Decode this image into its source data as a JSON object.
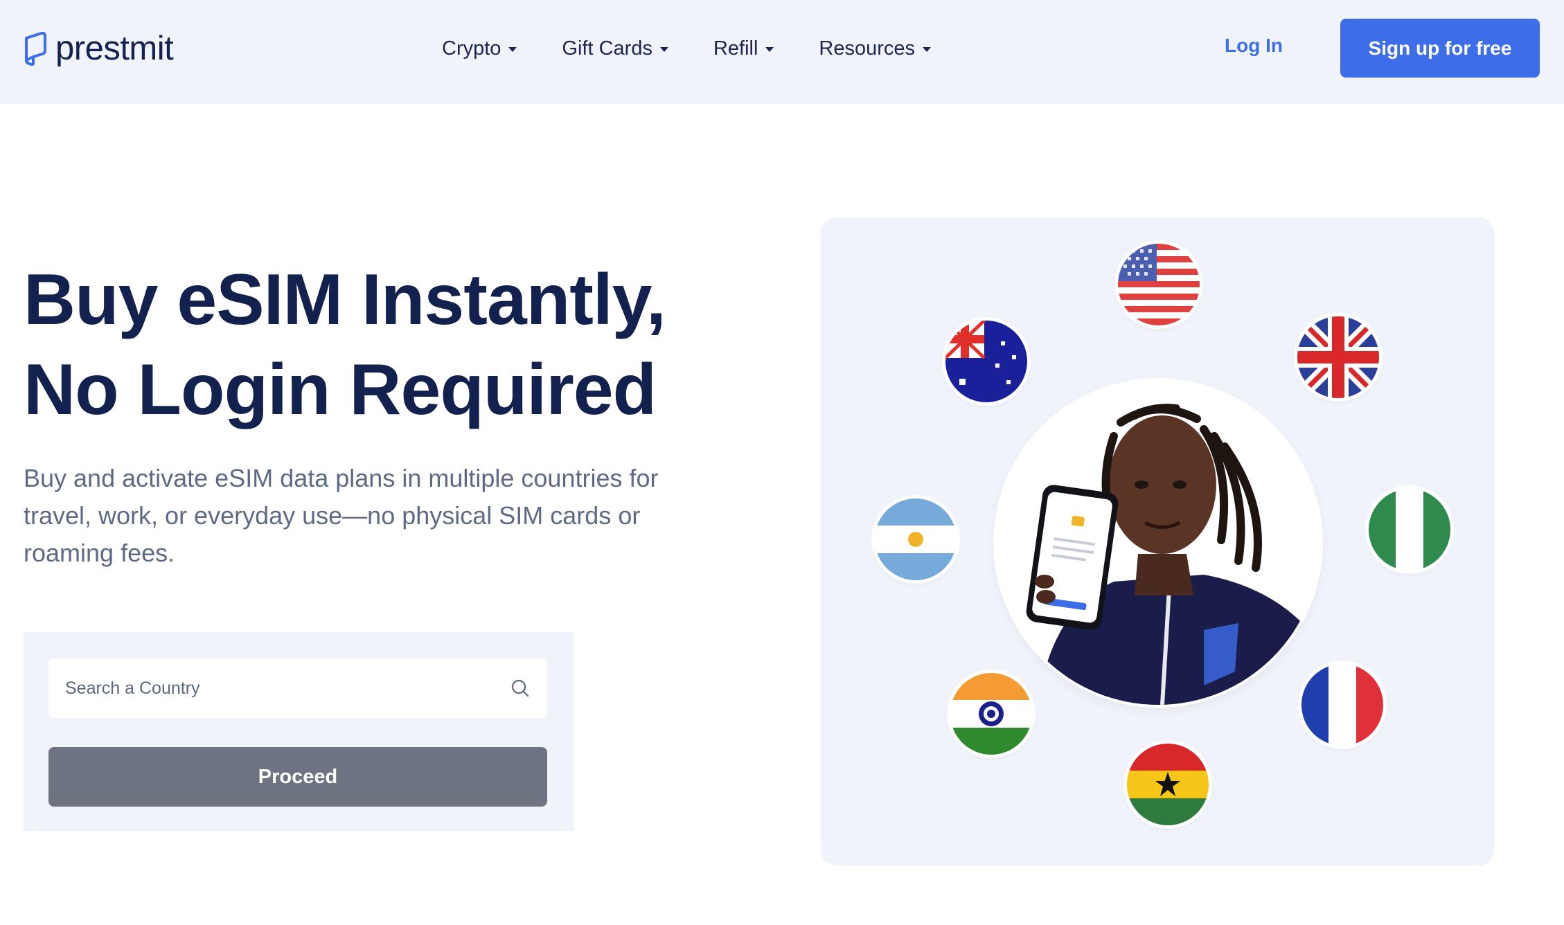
{
  "brand": {
    "name": "prestmit",
    "color": "#12214d",
    "accent": "#3d6de8"
  },
  "nav": {
    "items": [
      {
        "label": "Crypto"
      },
      {
        "label": "Gift Cards"
      },
      {
        "label": "Refill"
      },
      {
        "label": "Resources"
      }
    ],
    "login_label": "Log In",
    "signup_label": "Sign up for free"
  },
  "hero": {
    "title_line1": "Buy eSIM Instantly,",
    "title_line2": "No Login Required",
    "subtitle": "Buy and activate eSIM data plans in multiple countries for travel, work, or everyday use—no physical SIM cards or roaming fees."
  },
  "search": {
    "placeholder": "Search a Country",
    "value": "",
    "icon": "search-icon",
    "proceed_label": "Proceed"
  },
  "visual": {
    "flags": [
      "united-states",
      "australia",
      "united-kingdom",
      "argentina",
      "nigeria",
      "india",
      "france",
      "ghana"
    ],
    "portrait": "man holding phone with eSIM app"
  }
}
